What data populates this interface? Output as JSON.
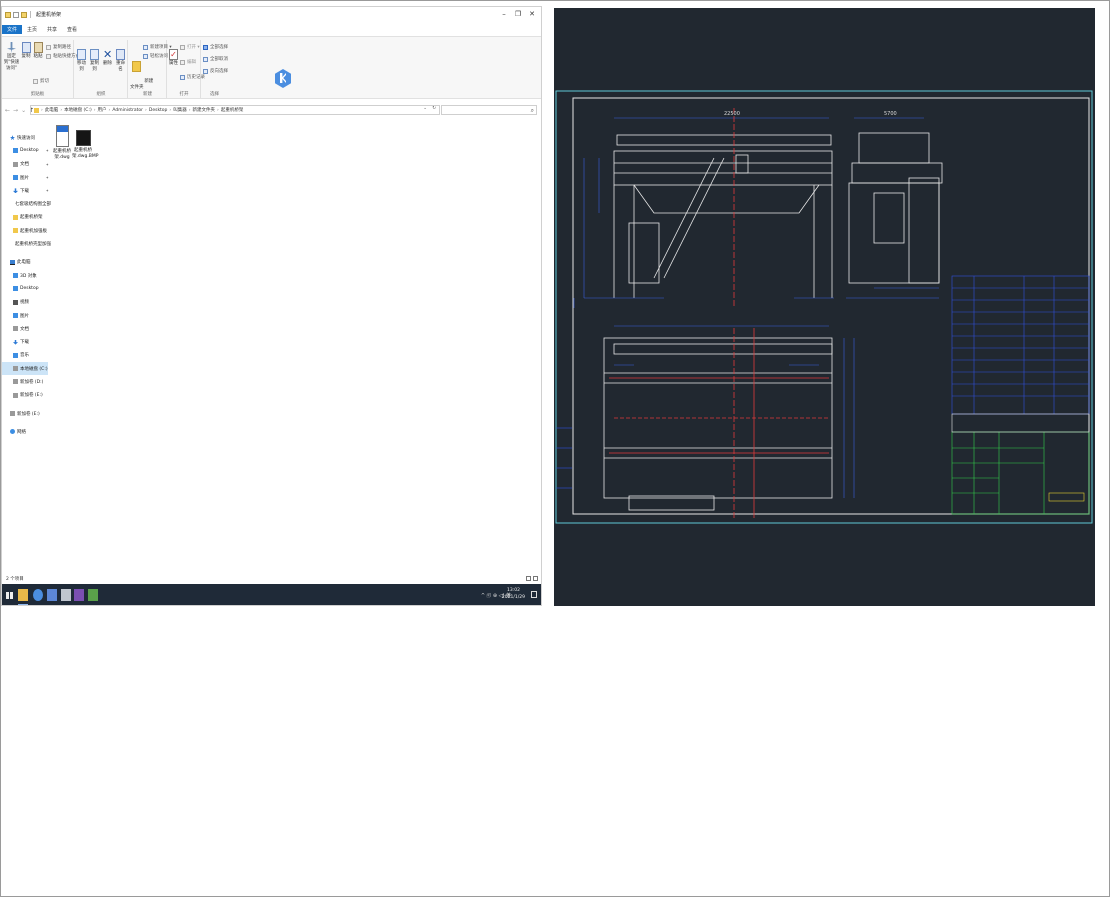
{
  "explorer": {
    "title": "起重机桥架",
    "controls": {
      "minimize": "–",
      "maximize": "❐",
      "close": "✕"
    },
    "tabs": [
      "文件",
      "主页",
      "共享",
      "查看"
    ],
    "ribbon": {
      "clipboard": {
        "label": "剪贴板",
        "pin": "固定到\"快速访问\"",
        "copy": "复制",
        "paste": "粘贴",
        "copy_path": "复制路径",
        "paste_shortcut": "粘贴快捷方式",
        "cut": "剪切"
      },
      "organize": {
        "label": "组织",
        "move_to": "移动到",
        "copy_to": "复制到",
        "delete": "删除",
        "rename": "重命名"
      },
      "new": {
        "label": "新建",
        "new_folder": "新建\n文件夹",
        "new_item": "新建项目 ▾",
        "easy_access": "轻松访问 ▾"
      },
      "open": {
        "label": "打开",
        "properties": "属性",
        "open": "打开 ▾",
        "edit": "编辑",
        "history": "历史记录"
      },
      "select": {
        "label": "选择",
        "select_all": "全部选择",
        "select_none": "全部取消",
        "invert": "反向选择"
      }
    },
    "address": {
      "back": "←",
      "forward": "→",
      "recent": "⌄",
      "up": "↑",
      "crumbs": [
        "此电脑",
        "本地磁盘 (C:)",
        "用户",
        "Administrator",
        "Desktop",
        "叫集器",
        "新建文件夹",
        "起重机桥架"
      ],
      "separator": "›",
      "dropdown": "⌄",
      "refresh": "↻",
      "search_icon": "⌕"
    },
    "nav": {
      "quick_access": "快速访问",
      "quick_items": [
        "Desktop",
        "文档",
        "图片",
        "下载",
        "七套吸结构图全部",
        "起重机桥架",
        "起重机加强板",
        "起重机桥壳型加强"
      ],
      "this_pc": "此电脑",
      "pc_items": [
        "3D 对象",
        "Desktop",
        "视频",
        "图片",
        "文档",
        "下载",
        "音乐",
        "本地磁盘 (C:)",
        "新加卷 (D:)",
        "新加卷 (E:)"
      ],
      "network_drive": "新加卷 (E:)",
      "network": "网络"
    },
    "files": [
      {
        "name": "起重机桥架.dwg"
      },
      {
        "name": "起重机桥架.dwg.BMP"
      }
    ],
    "status": "2 个项目",
    "taskbar": {
      "tray": "^ 🗊 ⊕ ◁) 英",
      "time": "13:02",
      "date": "2021/1/29"
    }
  },
  "colors": {
    "cad_background": "#212830",
    "accent": "#1a73c8",
    "taskbar": "#1f2a38"
  }
}
